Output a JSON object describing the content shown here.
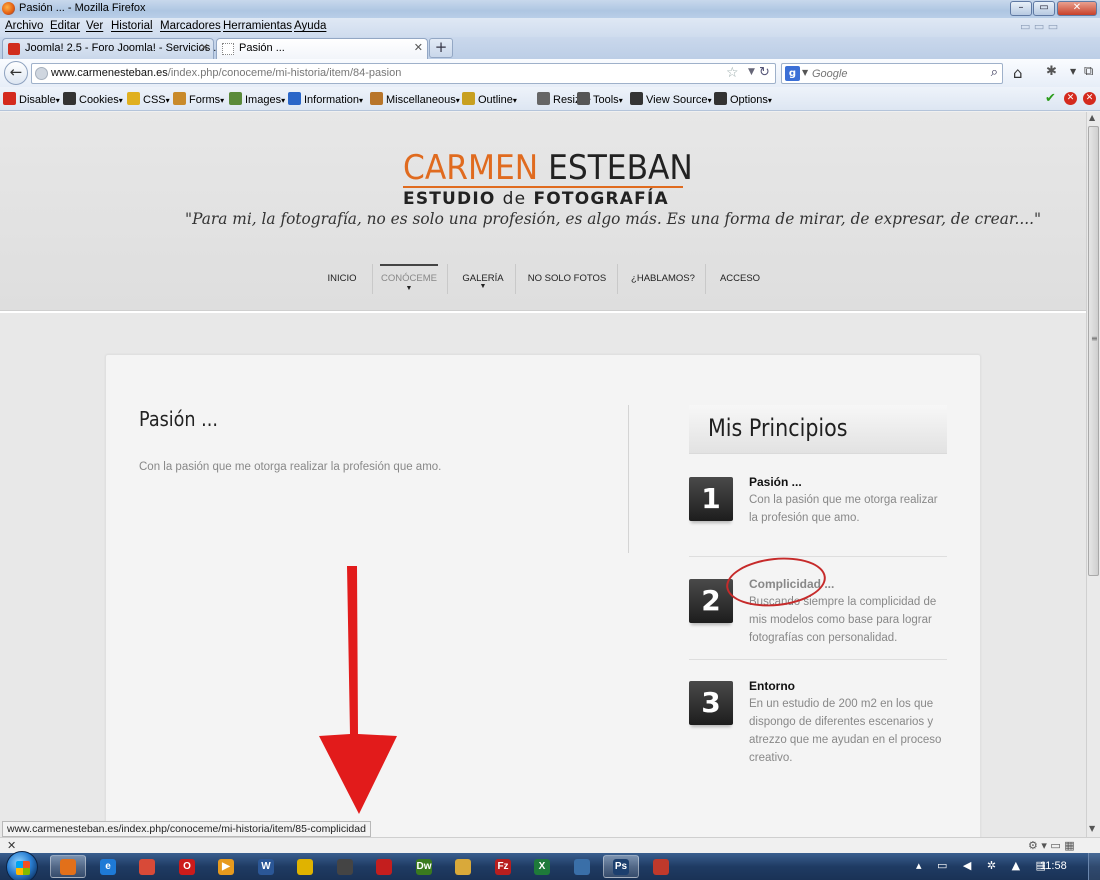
{
  "window": {
    "title": "Pasión ... - Mozilla Firefox",
    "min": "–",
    "max": "▭",
    "close": "✕"
  },
  "menu": [
    "Archivo",
    "Editar",
    "Ver",
    "Historial",
    "Marcadores",
    "Herramientas",
    "Ayuda"
  ],
  "tabs": [
    {
      "label": "Joomla! 2.5 - Foro Joomla! - Servicios ...",
      "close": "✕"
    },
    {
      "label": "Pasión ...",
      "close": "✕"
    }
  ],
  "newtab": "+",
  "navbar": {
    "back": "←",
    "url_domain": "www.carmenesteban.es",
    "url_path": "/index.php/conoceme/mi-historia/item/84-pasion",
    "search_placeholder": "Google"
  },
  "devtoolbar": [
    {
      "label": "Disable",
      "icon": "disable-icon",
      "color": "#d42a1e"
    },
    {
      "label": "Cookies",
      "icon": "cookies-icon",
      "color": "#333333"
    },
    {
      "label": "CSS",
      "icon": "css-icon",
      "color": "#e0b020"
    },
    {
      "label": "Forms",
      "icon": "forms-icon",
      "color": "#c98a2a"
    },
    {
      "label": "Images",
      "icon": "images-icon",
      "color": "#5a8a3a"
    },
    {
      "label": "Information",
      "icon": "information-icon",
      "color": "#2a66c8"
    },
    {
      "label": "Miscellaneous",
      "icon": "miscellaneous-icon",
      "color": "#b8752a"
    },
    {
      "label": "Outline",
      "icon": "outline-icon",
      "color": "#c8a020"
    },
    {
      "label": "Resize",
      "icon": "resize-icon",
      "color": "#666666"
    },
    {
      "label": "Tools",
      "icon": "tools-icon",
      "color": "#555555"
    },
    {
      "label": "View Source",
      "icon": "view-source-icon",
      "color": "#333333"
    },
    {
      "label": "Options",
      "icon": "options-icon",
      "color": "#333333"
    }
  ],
  "site": {
    "logo_first": "CARMEN",
    "logo_last": "ESTEBAN",
    "logo_sub_a": "ESTUDIO ",
    "logo_sub_de": "de",
    "logo_sub_b": " FOTOGRAFÍA",
    "tagline": "\"Para mi, la fotografía, no es solo una profesión, es algo más. Es una forma de mirar, de expresar, de crear....\"",
    "nav": [
      {
        "label": "INICIO"
      },
      {
        "label": "CONÓCEME",
        "submenu": true,
        "active": true
      },
      {
        "label": "GALERÍA",
        "submenu": true
      },
      {
        "label": "NO SOLO FOTOS"
      },
      {
        "label": "¿HABLAMOS?"
      },
      {
        "label": "ACCESO"
      }
    ],
    "brand_color": "#e06b1f"
  },
  "article": {
    "title": "Pasión ...",
    "text": "Con la pasión que me otorga realizar la profesión que amo."
  },
  "sidebar": {
    "title": "Mis Principios",
    "items": [
      {
        "num": "1",
        "title": "Pasión ...",
        "text": "Con la pasión que me otorga realizar la profesión que amo."
      },
      {
        "num": "2",
        "title": "Complicidad ...",
        "text": "Buscando siempre la complicidad de mis modelos como base para lograr fotografías con personalidad."
      },
      {
        "num": "3",
        "title": "Entorno",
        "text": "En un estudio de 200 m2 en los que dispongo de diferentes escenarios y atrezzo que me ayudan en el proceso creativo."
      }
    ]
  },
  "annotation_color": "#e21b1b",
  "status": {
    "url": "www.carmenesteban.es/index.php/conoceme/mi-historia/item/85-complicidad",
    "close": "✕"
  },
  "taskbar": {
    "apps": [
      {
        "name": "firefox",
        "glyph": "",
        "color": "#e2701a",
        "on": true
      },
      {
        "name": "internet-explorer",
        "glyph": "e",
        "color": "#1e7ad6",
        "on": false
      },
      {
        "name": "chrome",
        "glyph": "",
        "color": "#d84a38",
        "on": false
      },
      {
        "name": "opera",
        "glyph": "O",
        "color": "#cc1b1b",
        "on": false
      },
      {
        "name": "media-player",
        "glyph": "▶",
        "color": "#e79a1e",
        "on": false
      },
      {
        "name": "word",
        "glyph": "W",
        "color": "#2b5797",
        "on": false
      },
      {
        "name": "notes",
        "glyph": "",
        "color": "#e0b300",
        "on": false
      },
      {
        "name": "disc",
        "glyph": "",
        "color": "#444444",
        "on": false
      },
      {
        "name": "acrobat",
        "glyph": "",
        "color": "#c41e1e",
        "on": false
      },
      {
        "name": "dreamweaver",
        "glyph": "Dw",
        "color": "#3a7a1e",
        "on": false
      },
      {
        "name": "folder",
        "glyph": "",
        "color": "#d9a93a",
        "on": false
      },
      {
        "name": "filezilla",
        "glyph": "Fz",
        "color": "#b81e1e",
        "on": false
      },
      {
        "name": "excel",
        "glyph": "X",
        "color": "#1e7a3a",
        "on": false
      },
      {
        "name": "remote",
        "glyph": "",
        "color": "#3a6fa8",
        "on": false
      },
      {
        "name": "photoshop",
        "glyph": "Ps",
        "color": "#1c3f6e",
        "on": true
      },
      {
        "name": "filezilla-server",
        "glyph": "",
        "color": "#c0392b",
        "on": false
      }
    ],
    "clock": "11:58"
  }
}
